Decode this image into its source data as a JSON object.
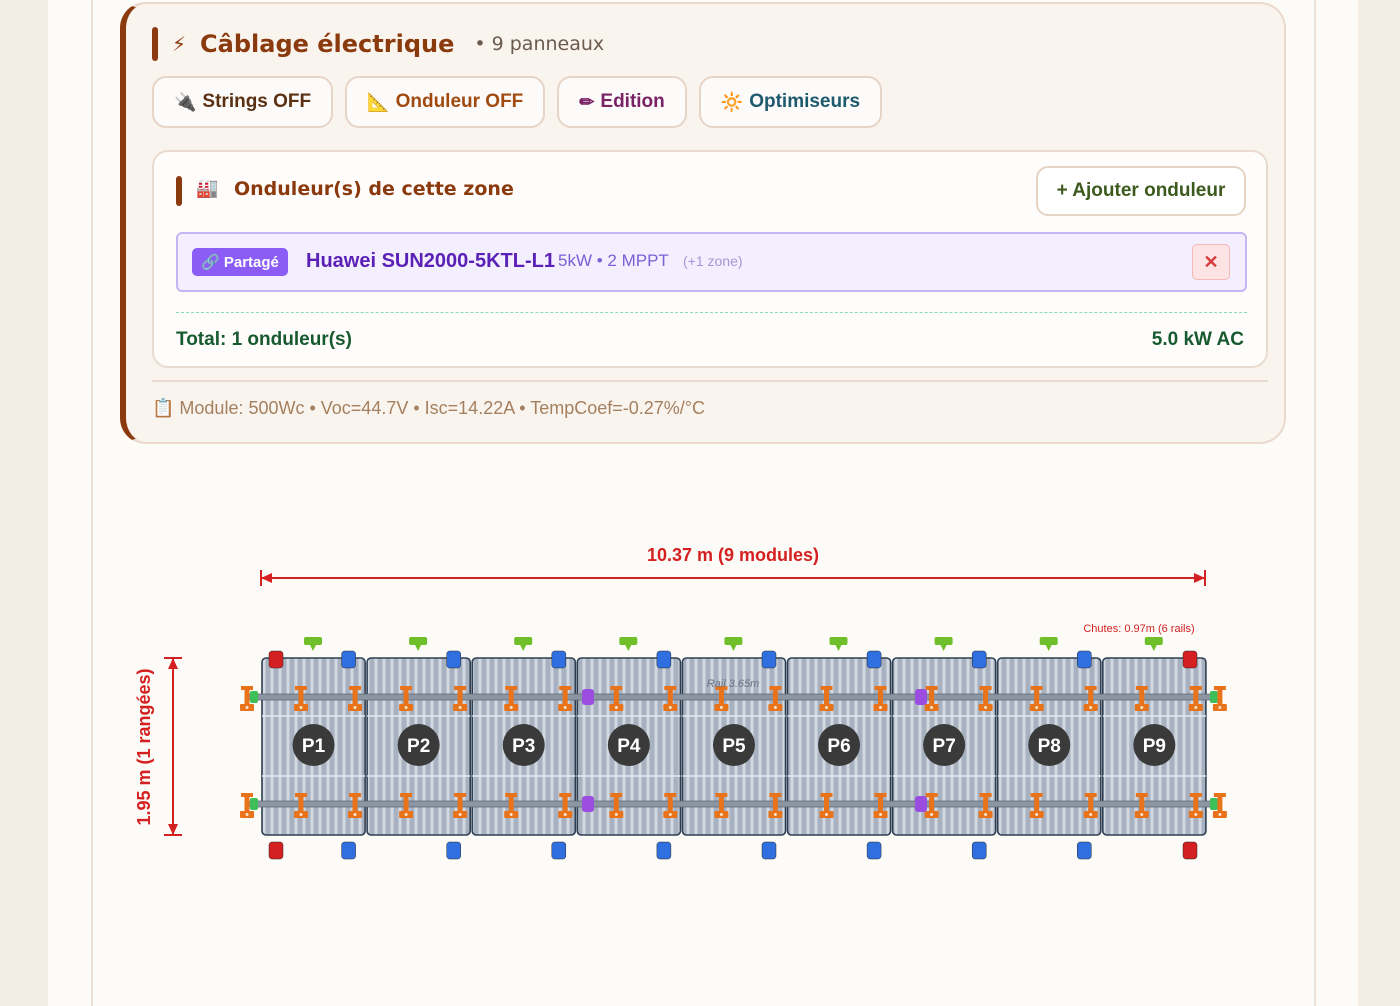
{
  "wiring": {
    "title": "Câblage électrique",
    "bolt_icon": "⚡",
    "panel_count": "• 9 panneaux",
    "buttons": [
      {
        "icon": "🔌",
        "label": "Strings OFF",
        "color": "#5a3112"
      },
      {
        "icon": "📐",
        "label": "Onduleur OFF",
        "color": "#a04a10"
      },
      {
        "icon": "✏",
        "label": "Edition",
        "color": "#7a2266"
      },
      {
        "icon": "🔆",
        "label": "Optimiseurs",
        "color": "#1e5a6e"
      }
    ]
  },
  "inverters": {
    "icon": "🏭",
    "title": "Onduleur(s) de cette zone",
    "add_label": "+ Ajouter onduleur",
    "items": [
      {
        "badge": "🔗 Partagé",
        "model": "Huawei SUN2000-5KTL-L1",
        "spec": "5kW • 2 MPPT",
        "zones": "(+1 zone)",
        "remove": "✕"
      }
    ],
    "total_label": "Total: 1 onduleur(s)",
    "total_value": "5.0 kW AC"
  },
  "module_info": "📋 Module: 500Wc • Voc=44.7V • Isc=14.22A • TempCoef=-0.27%/°C",
  "layout_diagram": {
    "width_label": "10.37 m (9 modules)",
    "height_label": "1.95 m (1 rangées)",
    "chutes_label": "Chutes: 0.97m (6 rails)",
    "rail_label": "Rail 3.65m",
    "panels": [
      "P1",
      "P2",
      "P3",
      "P4",
      "P5",
      "P6",
      "P7",
      "P8",
      "P9"
    ],
    "colors": {
      "accent": "#8b3a0e",
      "dimension": "#d42020",
      "clamp": "#e8731a",
      "end_clamp": "#d42020",
      "mid_clamp": "#2f6fe0",
      "splice": "#9b4de0",
      "green_marker": "#6fbf2a",
      "panel_fill": "#c4ccd8",
      "panel_border": "#2e3e52"
    }
  }
}
